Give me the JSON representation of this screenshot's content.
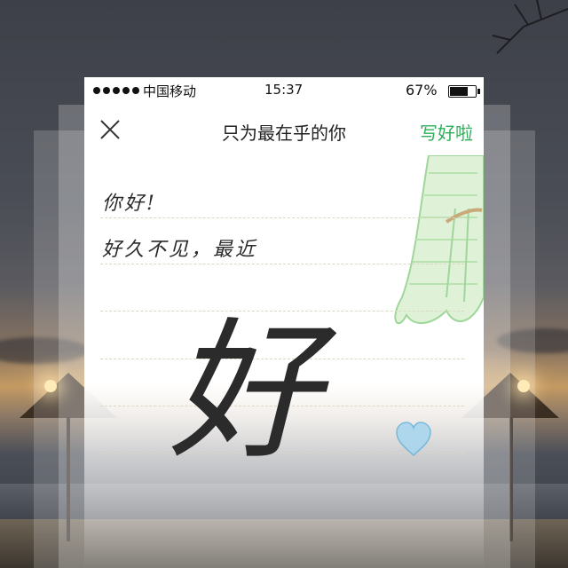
{
  "status_bar": {
    "carrier": "中国移动",
    "time": "15:37",
    "battery_percent": "67%",
    "battery_level": 0.67
  },
  "header": {
    "title": "只为最在乎的你",
    "done_label": "写好啦",
    "close_icon": "close-icon"
  },
  "letter": {
    "lines": [
      "你好!",
      "好久不见，最近"
    ],
    "big_character": "好"
  },
  "colors": {
    "accent": "#2fae59",
    "paper_rule": "#d9d9c0"
  }
}
